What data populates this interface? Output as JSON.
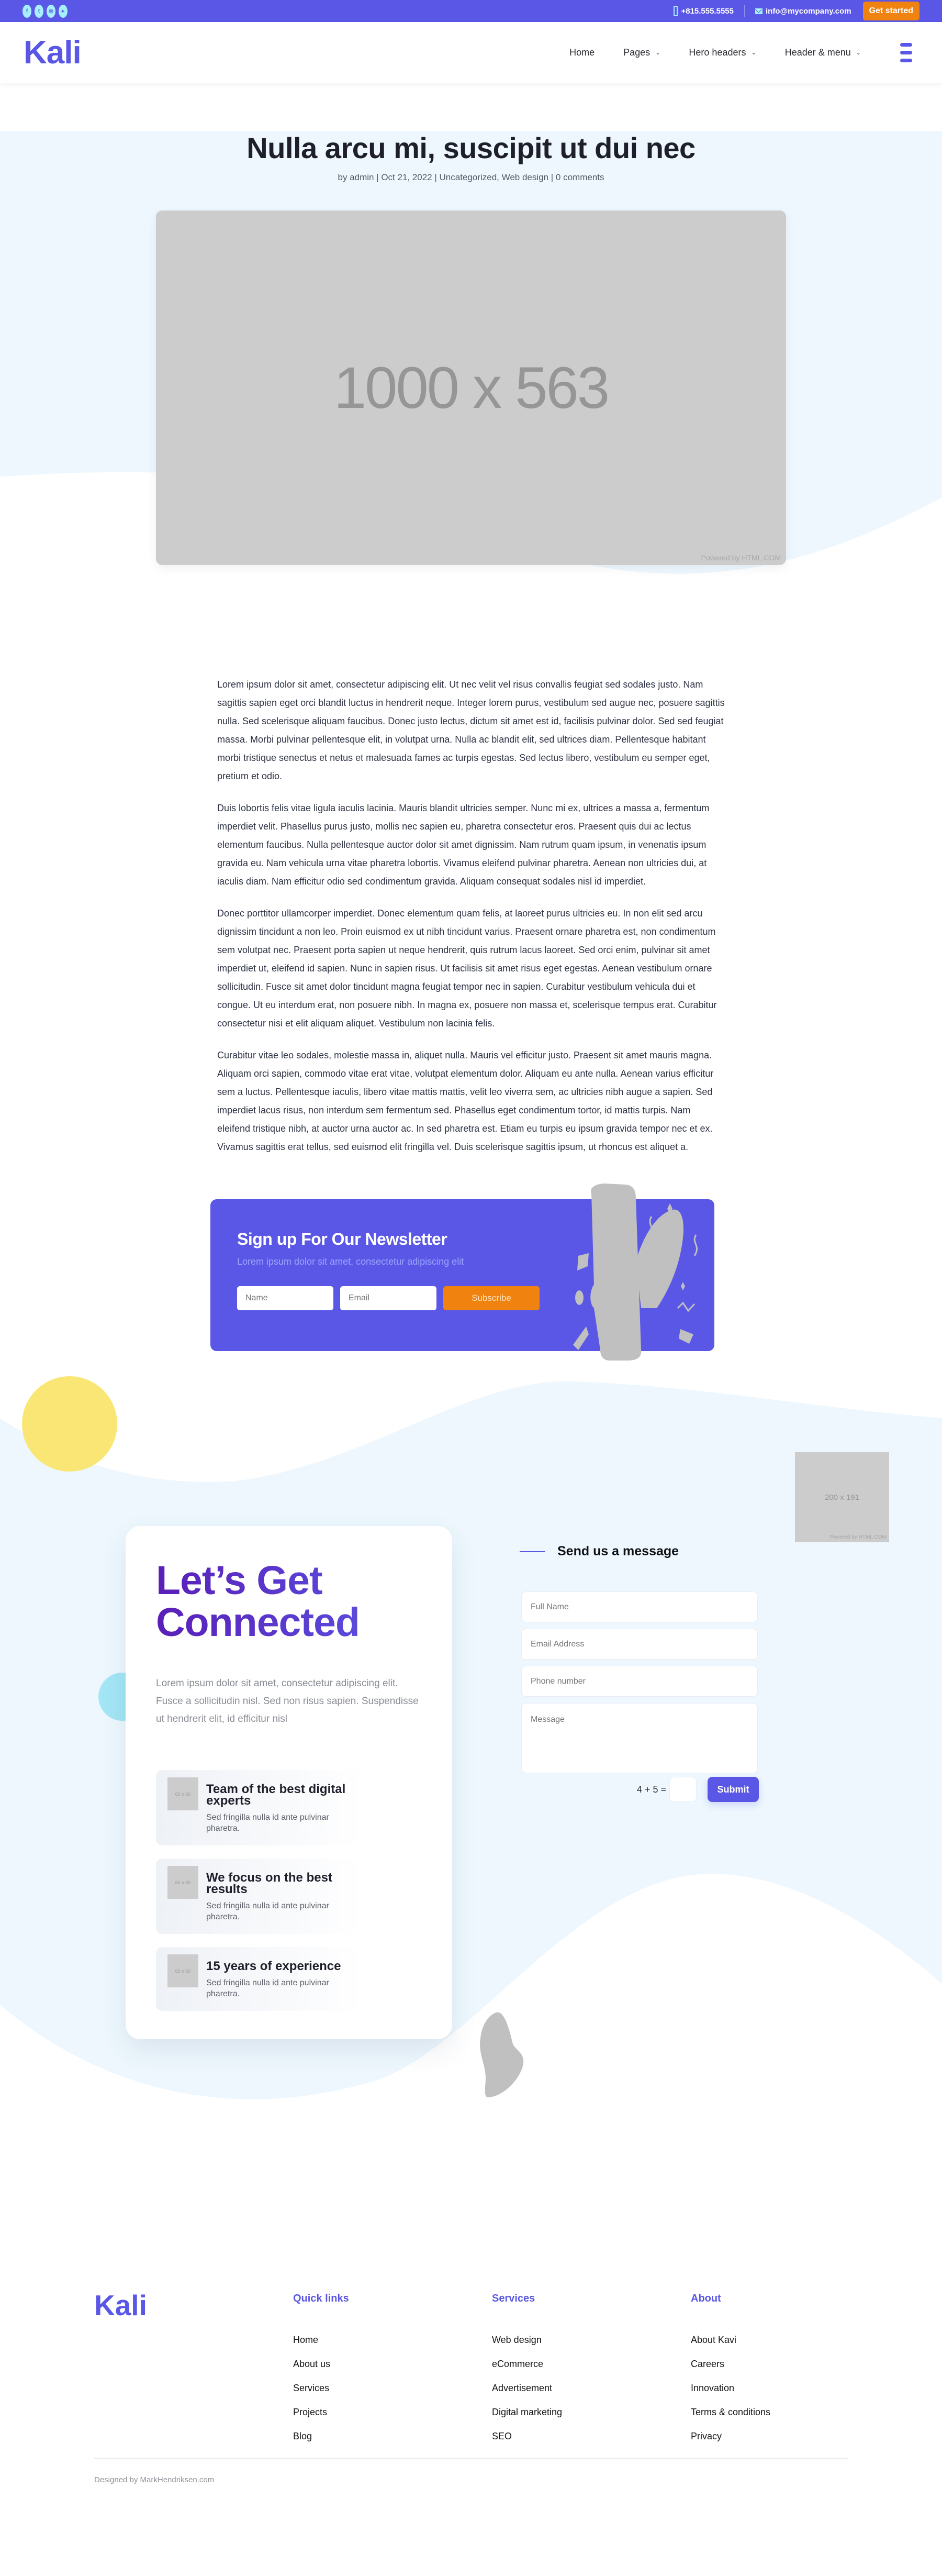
{
  "colors": {
    "brand": "#5a57e6",
    "accent_orange": "#f0830f",
    "hero_bg": "#edf7fd",
    "social_icon_bg": "#a6f0fb",
    "yellow_circle": "#fae674",
    "placeholder_gray": "#cccccc"
  },
  "topbar": {
    "socials": [
      {
        "icon": "facebook-icon",
        "glyph": "f"
      },
      {
        "icon": "twitter-icon",
        "glyph": "t"
      },
      {
        "icon": "instagram-icon",
        "glyph": "◎"
      },
      {
        "icon": "youtube-icon",
        "glyph": "▸"
      }
    ],
    "phone": "+815.555.5555",
    "email": "info@mycompany.com",
    "cta_label": "Get started"
  },
  "header": {
    "logo": "Kali",
    "nav": [
      {
        "label": "Home",
        "has_dropdown": false
      },
      {
        "label": "Pages",
        "has_dropdown": true
      },
      {
        "label": "Hero headers",
        "has_dropdown": true
      },
      {
        "label": "Header & menu",
        "has_dropdown": true
      }
    ],
    "chevron": "⌄"
  },
  "post": {
    "title": "Nulla arcu mi, suscipit ut dui nec",
    "meta": "by admin | Oct 21, 2022 | Uncategorized, Web design | 0 comments",
    "featured_image_label": "1000 x 563",
    "powered_by": "Powered by HTML.COM",
    "paragraphs": [
      "Lorem ipsum dolor sit amet, consectetur adipiscing elit. Ut nec velit vel risus convallis feugiat sed sodales justo. Nam sagittis sapien eget orci blandit luctus in hendrerit neque. Integer lorem purus, vestibulum sed augue nec, posuere sagittis nulla. Sed scelerisque aliquam faucibus. Donec justo lectus, dictum sit amet est id, facilisis pulvinar dolor. Sed sed feugiat massa. Morbi pulvinar pellentesque elit, in volutpat urna. Nulla ac blandit elit, sed ultrices diam. Pellentesque habitant morbi tristique senectus et netus et malesuada fames ac turpis egestas. Sed lectus libero, vestibulum eu semper eget, pretium et odio.",
      "Duis lobortis felis vitae ligula iaculis lacinia. Mauris blandit ultricies semper. Nunc mi ex, ultrices a massa a, fermentum imperdiet velit. Phasellus purus justo, mollis nec sapien eu, pharetra consectetur eros. Praesent quis dui ac lectus elementum faucibus. Nulla pellentesque auctor dolor sit amet dignissim. Nam rutrum quam ipsum, in venenatis ipsum gravida eu. Nam vehicula urna vitae pharetra lobortis. Vivamus eleifend pulvinar pharetra. Aenean non ultricies dui, at iaculis diam. Nam efficitur odio sed condimentum gravida. Aliquam consequat sodales nisl id imperdiet.",
      "Donec porttitor ullamcorper imperdiet. Donec elementum quam felis, at laoreet purus ultricies eu. In non elit sed arcu dignissim tincidunt a non leo. Proin euismod ex ut nibh tincidunt varius. Praesent ornare pharetra est, non condimentum sem volutpat nec. Praesent porta sapien ut neque hendrerit, quis rutrum lacus laoreet. Sed orci enim, pulvinar sit amet imperdiet ut, eleifend id sapien. Nunc in sapien risus. Ut facilisis sit amet risus eget egestas. Aenean vestibulum ornare sollicitudin. Fusce sit amet dolor tincidunt magna feugiat tempor nec in sapien. Curabitur vestibulum vehicula dui et congue. Ut eu interdum erat, non posuere nibh. In magna ex, posuere non massa et, scelerisque tempus erat. Curabitur consectetur nisi et elit aliquam aliquet. Vestibulum non lacinia felis.",
      "Curabitur vitae leo sodales, molestie massa in, aliquet nulla. Mauris vel efficitur justo. Praesent sit amet mauris magna. Aliquam orci sapien, commodo vitae erat vitae, volutpat elementum dolor. Aliquam eu ante nulla. Aenean varius efficitur sem a luctus. Pellentesque iaculis, libero vitae mattis mattis, velit leo viverra sem, ac ultricies nibh augue a sapien. Sed imperdiet lacus risus, non interdum sem fermentum sed. Phasellus eget condimentum tortor, id mattis turpis. Nam eleifend tristique nibh, at auctor urna auctor ac. In sed pharetra est. Etiam eu turpis eu ipsum gravida tempor nec et ex. Vivamus sagittis erat tellus, sed euismod elit fringilla vel. Duis scelerisque sagittis ipsum, ut rhoncus est aliquet a."
    ]
  },
  "newsletter": {
    "title": "Sign up For Our Newsletter",
    "subtitle": "Lorem ipsum dolor sit amet, consectetur adipiscing elit",
    "name_placeholder": "Name",
    "email_placeholder": "Email",
    "button_label": "Subscribe"
  },
  "contact": {
    "side_image_label": "200 x 191",
    "powered_by": "Powered by HTML.COM",
    "card": {
      "title": "Let’s Get Connected",
      "description": "Lorem ipsum dolor sit amet, consectetur adipiscing elit. Fusce a sollicitudin nisl. Sed non risus sapien. Suspendisse ut hendrerit elit, id efficitur nisl",
      "features": [
        {
          "icon_label": "60 x 60",
          "title": "Team of the best digital experts",
          "desc": "Sed fringilla nulla id ante pulvinar pharetra."
        },
        {
          "icon_label": "60 x 60",
          "title": "We focus on the best results",
          "desc": "Sed fringilla nulla id ante pulvinar pharetra."
        },
        {
          "icon_label": "60 x 60",
          "title": "15 years of experience",
          "desc": "Sed fringilla nulla id ante pulvinar pharetra."
        }
      ]
    },
    "form": {
      "title": "Send us a message",
      "full_name_placeholder": "Full Name",
      "email_placeholder": "Email Address",
      "phone_placeholder": "Phone number",
      "message_placeholder": "Message",
      "captcha_question": "4 + 5 =",
      "captcha_value": "",
      "submit_label": "Submit"
    }
  },
  "footer": {
    "logo": "Kali",
    "columns": [
      {
        "heading": "Quick links",
        "links": [
          "Home",
          "About us",
          "Services",
          "Projects",
          "Blog"
        ]
      },
      {
        "heading": "Services",
        "links": [
          "Web design",
          "eCommerce",
          "Advertisement",
          "Digital marketing",
          "SEO"
        ]
      },
      {
        "heading": "About",
        "links": [
          "About Kavi",
          "Careers",
          "Innovation",
          "Terms & conditions",
          "Privacy"
        ]
      }
    ],
    "copyright": "Designed by MarkHendriksen.com"
  }
}
